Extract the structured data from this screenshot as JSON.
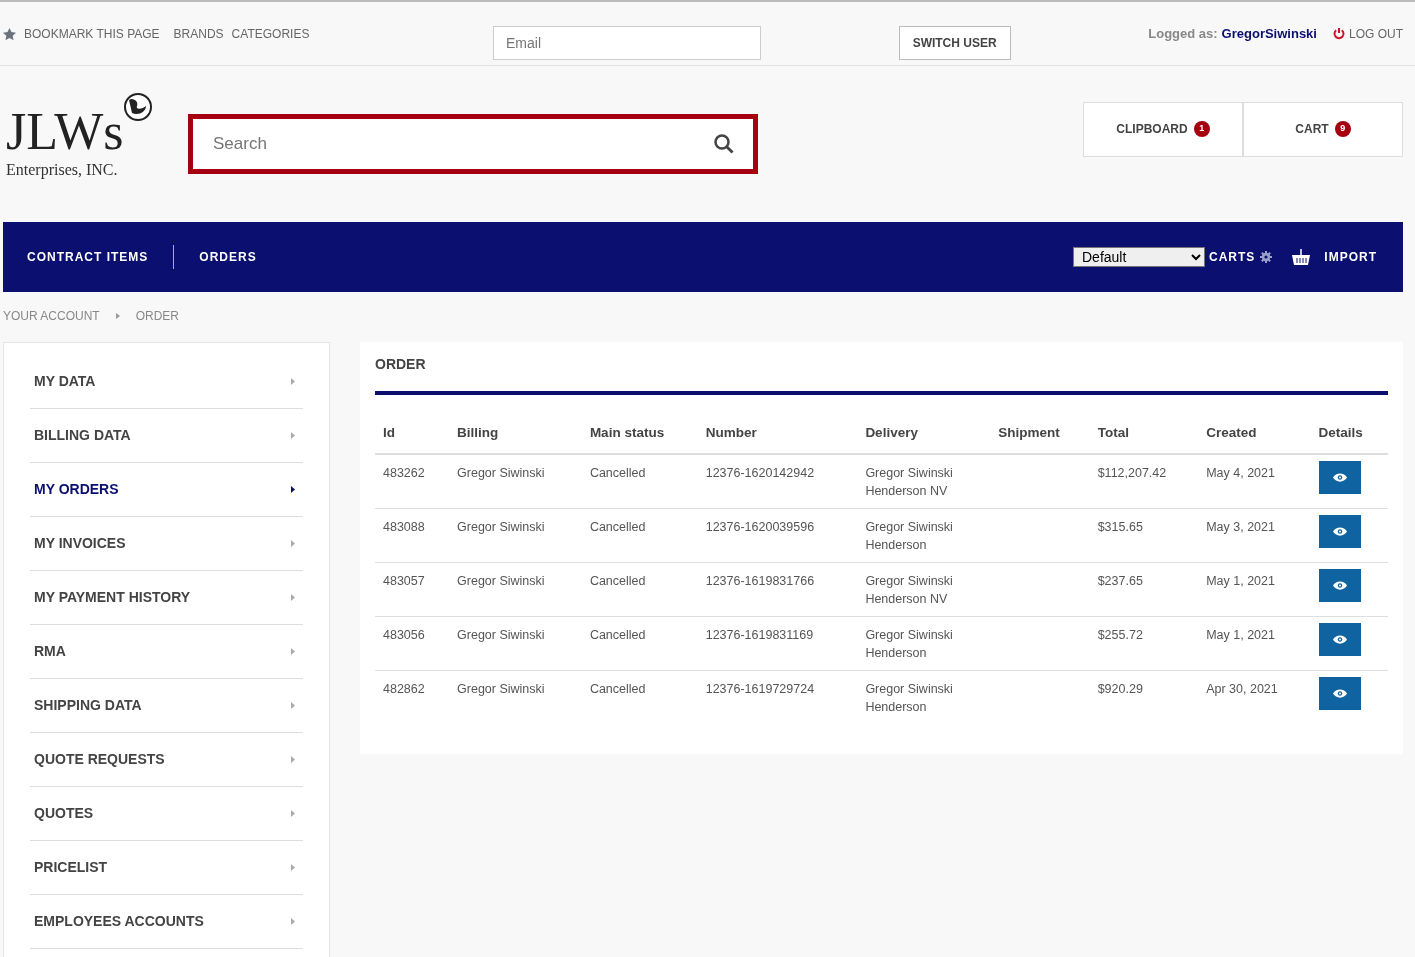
{
  "top_bar": {
    "links": [
      "BOOKMARK THIS PAGE",
      "BRANDS",
      "CATEGORIES"
    ],
    "email": {
      "placeholder": "Email"
    },
    "switch_button": "SWITCH USER",
    "logged_label": "Logged as:",
    "user": "GregorSiwinski",
    "logout": "LOG OUT"
  },
  "logo": {
    "wordmark": "JLWs",
    "subtitle": "Enterprises, INC."
  },
  "search": {
    "placeholder": "Search"
  },
  "header_buttons": [
    {
      "label": "CLIPBOARD",
      "count": "1"
    },
    {
      "label": "CART",
      "count": "9"
    }
  ],
  "nav": {
    "items": [
      "CONTRACT ITEMS",
      "ORDERS"
    ],
    "cart_select": "Default",
    "carts": "CARTS",
    "import": "IMPORT"
  },
  "breadcrumb": [
    "YOUR ACCOUNT",
    "ORDER"
  ],
  "sidebar": {
    "items": [
      {
        "label": "MY DATA",
        "selected": false
      },
      {
        "label": "BILLING DATA",
        "selected": false
      },
      {
        "label": "MY ORDERS",
        "selected": true
      },
      {
        "label": "MY INVOICES",
        "selected": false
      },
      {
        "label": "MY PAYMENT HISTORY",
        "selected": false
      },
      {
        "label": "RMA",
        "selected": false
      },
      {
        "label": "SHIPPING DATA",
        "selected": false
      },
      {
        "label": "QUOTE REQUESTS",
        "selected": false
      },
      {
        "label": "QUOTES",
        "selected": false
      },
      {
        "label": "PRICELIST",
        "selected": false
      },
      {
        "label": "EMPLOYEES ACCOUNTS",
        "selected": false
      }
    ]
  },
  "panel": {
    "title": "ORDER",
    "table": {
      "columns": [
        "Id",
        "Billing",
        "Main status",
        "Number",
        "Delivery",
        "Shipment",
        "Total",
        "Created",
        "Details"
      ],
      "rows": [
        {
          "id": "483262",
          "billing": "Gregor Siwinski",
          "status": "Cancelled",
          "number": "12376-1620142942",
          "delivery": [
            "Gregor Siwinski",
            "Henderson NV"
          ],
          "total": "$112,207.42",
          "created": "May 4, 2021"
        },
        {
          "id": "483088",
          "billing": "Gregor Siwinski",
          "status": "Cancelled",
          "number": "12376-1620039596",
          "delivery": [
            "Gregor Siwinski",
            "Henderson"
          ],
          "total": "$315.65",
          "created": "May 3, 2021"
        },
        {
          "id": "483057",
          "billing": "Gregor Siwinski",
          "status": "Cancelled",
          "number": "12376-1619831766",
          "delivery": [
            "Gregor Siwinski",
            "Henderson NV"
          ],
          "total": "$237.65",
          "created": "May 1, 2021"
        },
        {
          "id": "483056",
          "billing": "Gregor Siwinski",
          "status": "Cancelled",
          "number": "12376-1619831169",
          "delivery": [
            "Gregor Siwinski",
            "Henderson"
          ],
          "total": "$255.72",
          "created": "May 1, 2021"
        },
        {
          "id": "482862",
          "billing": "Gregor Siwinski",
          "status": "Cancelled",
          "number": "12376-1619729724",
          "delivery": [
            "Gregor Siwinski",
            "Henderson"
          ],
          "total": "$920.29",
          "created": "Apr 30, 2021"
        }
      ]
    }
  }
}
